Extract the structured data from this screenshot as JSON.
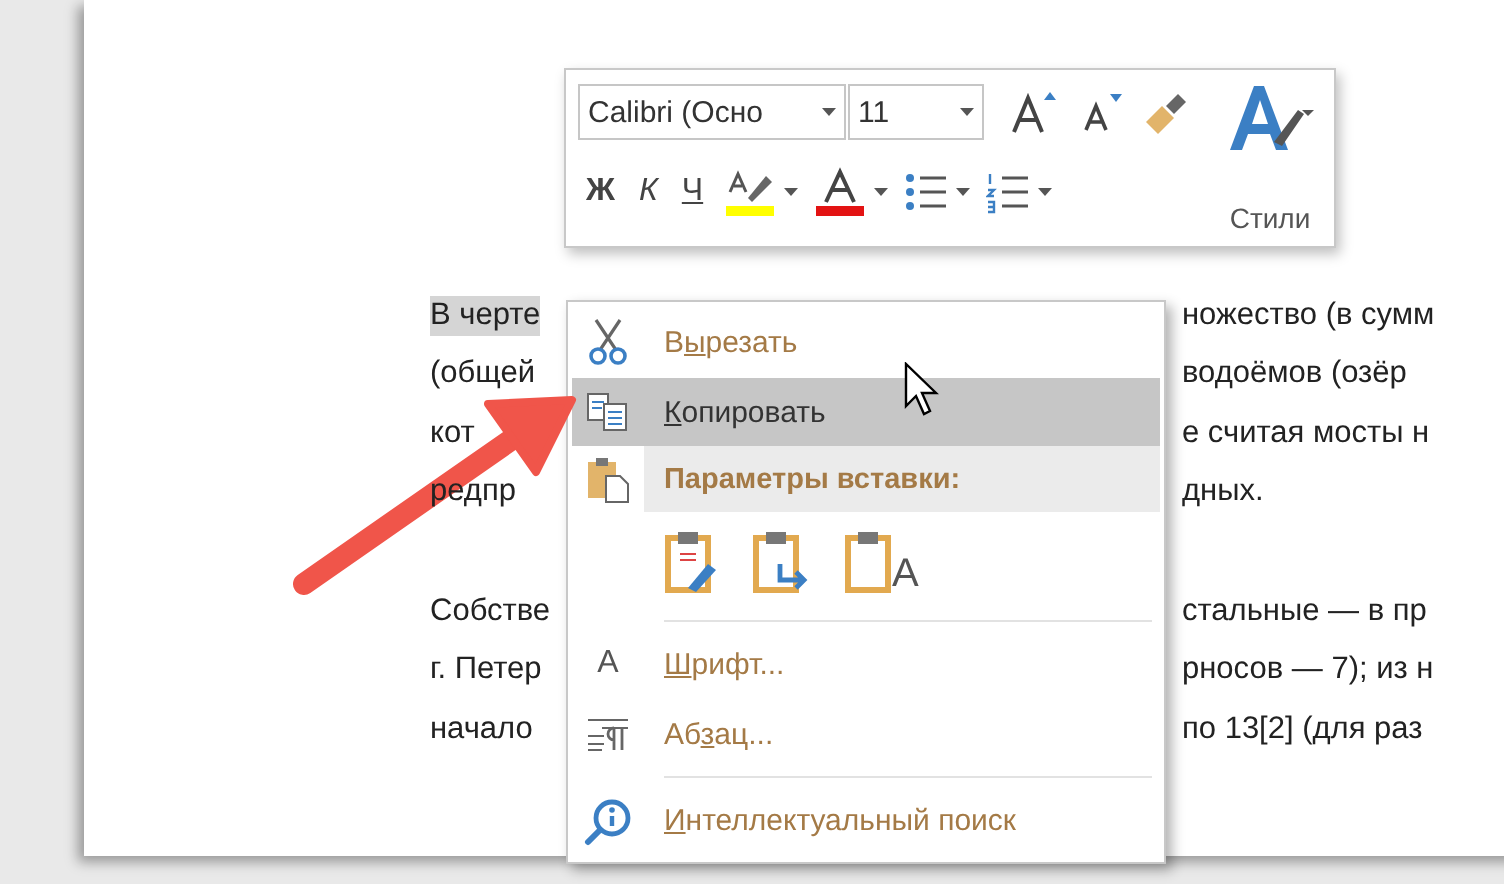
{
  "document": {
    "paragraphs": [
      {
        "lines": [
          {
            "left": "В черте",
            "right": "ножество (в сумм",
            "selected": true
          },
          {
            "left": "(общей",
            "right": "водоёмов (озёр",
            "selected": false
          },
          {
            "left": "кот",
            "right": "е считая мосты н",
            "selected": false
          },
          {
            "left": "редпр",
            "right": "дных.",
            "selected": false
          }
        ]
      },
      {
        "lines": [
          {
            "left": "Собстве",
            "right": "стальные — в пр",
            "selected": false
          },
          {
            "left": "г. Петер",
            "right": "рносов — 7); из н",
            "selected": false
          },
          {
            "left": "начало",
            "right": "по 13[2] (для раз",
            "selected": false
          }
        ]
      }
    ]
  },
  "mini_toolbar": {
    "font": {
      "value": "Calibri (Осно"
    },
    "size": {
      "value": "11"
    },
    "format_buttons": [
      {
        "kind": "bold",
        "label": "Ж"
      },
      {
        "kind": "italic",
        "label": "К"
      },
      {
        "kind": "underline",
        "label": "Ч"
      }
    ],
    "styles_label": "Стили"
  },
  "context_menu": {
    "items": [
      {
        "kind": "item",
        "label": {
          "before": "В",
          "key": "ы",
          "after": "резать"
        },
        "selected": false
      },
      {
        "kind": "item",
        "label": {
          "key": "К",
          "after": "опировать"
        },
        "selected": true
      },
      {
        "kind": "header",
        "label": "Параметры вставки:"
      },
      {
        "kind": "paste_options",
        "options": [
          {
            "kind": "keep_formatting"
          },
          {
            "kind": "merge"
          },
          {
            "kind": "text_only",
            "glyph": "A"
          }
        ]
      },
      {
        "kind": "separator"
      },
      {
        "kind": "item",
        "glyph": "A",
        "label": {
          "key": "Ш",
          "after": "рифт..."
        },
        "selected": false
      },
      {
        "kind": "item",
        "label": {
          "before": "Аб",
          "key": "з",
          "after": "ац..."
        },
        "selected": false
      },
      {
        "kind": "separator"
      },
      {
        "kind": "item",
        "label": {
          "key": "И",
          "after": "нтеллектуальный поиск"
        },
        "selected": false
      }
    ]
  }
}
